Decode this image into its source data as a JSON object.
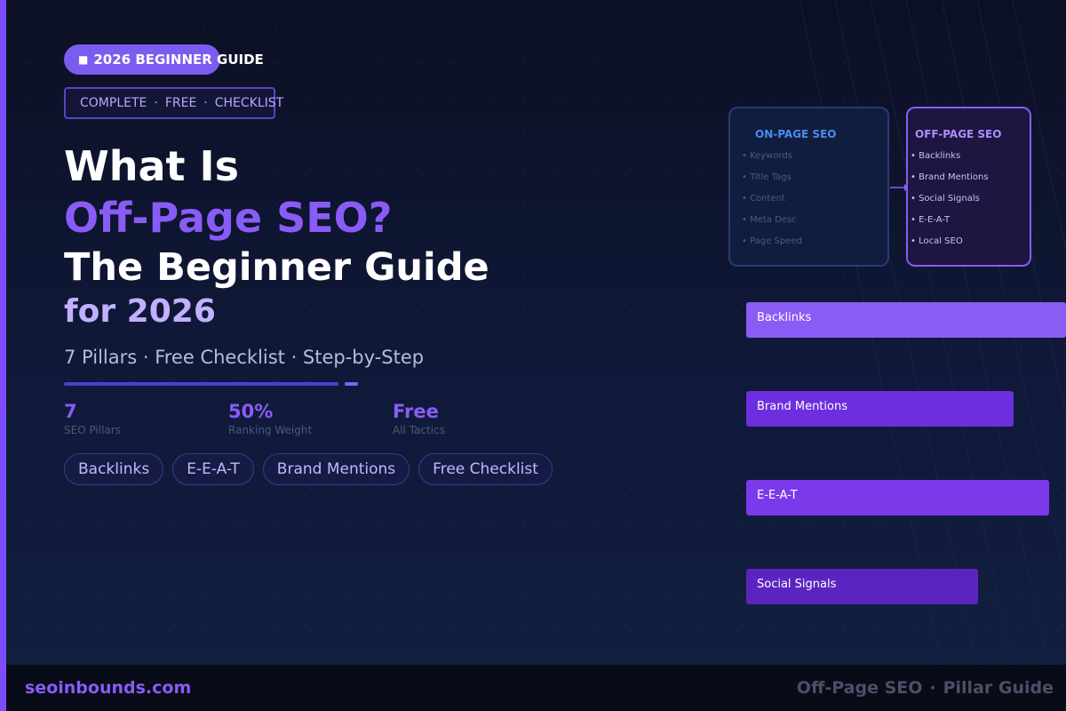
{
  "eyebrow": {
    "icon": "book-icon",
    "label": "2026 BEGINNER GUIDE"
  },
  "subtag": {
    "items": [
      "COMPLETE",
      "FREE",
      "CHECKLIST"
    ],
    "separator": "·"
  },
  "headline": {
    "line1": "What Is",
    "line2": "Off-Page SEO?",
    "line3": "The Beginner Guide",
    "line4": "for 2026"
  },
  "tagline": "7 Pillars · Free Checklist · Step-by-Step",
  "stats": [
    {
      "value": "7",
      "label": "SEO Pillars"
    },
    {
      "value": "50%",
      "label": "Ranking Weight"
    },
    {
      "value": "Free",
      "label": "All Tactics"
    }
  ],
  "chips": [
    "Backlinks",
    "E-E-A-T",
    "Brand Mentions",
    "Free Checklist"
  ],
  "on_page_card": {
    "title": "ON-PAGE SEO",
    "items": [
      "Keywords",
      "Title Tags",
      "Content",
      "Meta Desc",
      "Page Speed"
    ]
  },
  "off_page_card": {
    "title": "OFF-PAGE SEO",
    "items": [
      "Backlinks",
      "Brand Mentions",
      "Social Signals",
      "E-E-A-T",
      "Local SEO"
    ]
  },
  "bars": [
    {
      "label": "Backlinks",
      "color": "#8a5cf6"
    },
    {
      "label": "Brand Mentions",
      "color": "#6d2ee0"
    },
    {
      "label": "E-E-A-T",
      "color": "#7b3aea"
    },
    {
      "label": "Social Signals",
      "color": "#5b24c0"
    }
  ],
  "footer": {
    "site": "seoinbounds.com",
    "topic": "Off-Page SEO",
    "separator": "·",
    "type": "Pillar Guide"
  },
  "colors": {
    "accent": "#8a5cf6",
    "accent_light": "#c2b0ff",
    "background": "#0c1024",
    "on_page_title": "#4c8cf0"
  }
}
